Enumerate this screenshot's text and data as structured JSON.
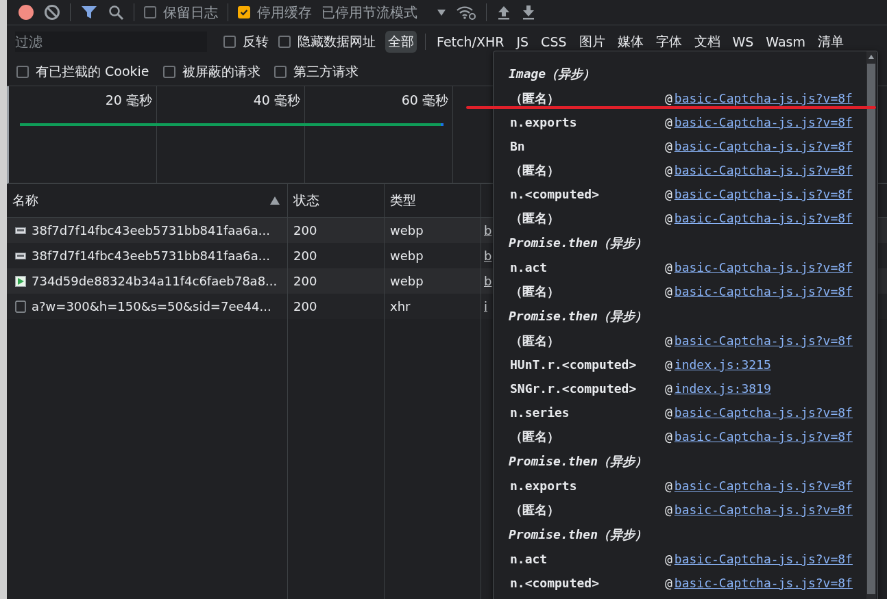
{
  "toolbar": {
    "checkboxes": [
      {
        "label": "保留日志",
        "checked": false
      },
      {
        "label": "停用缓存",
        "checked": true
      }
    ],
    "throttle": "已停用节流模式"
  },
  "filter": {
    "placeholder": "过滤",
    "options": [
      {
        "label": "反转",
        "checked": false
      },
      {
        "label": "隐藏数据网址",
        "checked": false
      }
    ],
    "types": [
      {
        "label": "全部",
        "selected": true
      },
      {
        "label": "Fetch/XHR",
        "selected": false
      },
      {
        "label": "JS",
        "selected": false
      },
      {
        "label": "CSS",
        "selected": false
      },
      {
        "label": "图片",
        "selected": false
      },
      {
        "label": "媒体",
        "selected": false
      },
      {
        "label": "字体",
        "selected": false
      },
      {
        "label": "文档",
        "selected": false
      },
      {
        "label": "WS",
        "selected": false
      },
      {
        "label": "Wasm",
        "selected": false
      },
      {
        "label": "清单",
        "selected": false
      }
    ]
  },
  "more_filters": [
    {
      "label": "有已拦截的 Cookie",
      "checked": false
    },
    {
      "label": "被屏蔽的请求",
      "checked": false
    },
    {
      "label": "第三方请求",
      "checked": false
    }
  ],
  "timeline": {
    "ticks": [
      "20 毫秒",
      "40 毫秒",
      "60 毫秒"
    ]
  },
  "table": {
    "columns": [
      "名称",
      "状态",
      "类型"
    ],
    "rows": [
      {
        "kind": "image",
        "name": "38f7d7f14fbc43eeb5731bb841faa6a...",
        "status": "200",
        "type": "webp",
        "initiator": "b"
      },
      {
        "kind": "image",
        "name": "38f7d7f14fbc43eeb5731bb841faa6a...",
        "status": "200",
        "type": "webp",
        "initiator": "b"
      },
      {
        "kind": "picture",
        "name": "734d59de88324b34a11f4c6faeb78a8...",
        "status": "200",
        "type": "webp",
        "initiator": "b"
      },
      {
        "kind": "document",
        "name": "a?w=300&h=150&s=50&sid=7ee44...",
        "status": "200",
        "type": "xhr",
        "initiator": "i"
      }
    ]
  },
  "initiator_popup": {
    "entries": [
      {
        "kind": "async",
        "label": "Image（异步）"
      },
      {
        "kind": "frame",
        "function": "（匿名）",
        "at": "@",
        "location": "basic-Captcha-js.js?v=8f"
      },
      {
        "kind": "frame",
        "function": "n.exports",
        "at": "@",
        "location": "basic-Captcha-js.js?v=8f"
      },
      {
        "kind": "frame",
        "function": "Bn",
        "at": "@",
        "location": "basic-Captcha-js.js?v=8f"
      },
      {
        "kind": "frame",
        "function": "（匿名）",
        "at": "@",
        "location": "basic-Captcha-js.js?v=8f"
      },
      {
        "kind": "frame",
        "function": "n.<computed>",
        "at": "@",
        "location": "basic-Captcha-js.js?v=8f"
      },
      {
        "kind": "frame",
        "function": "（匿名）",
        "at": "@",
        "location": "basic-Captcha-js.js?v=8f"
      },
      {
        "kind": "async",
        "label": "Promise.then（异步）"
      },
      {
        "kind": "frame",
        "function": "n.act",
        "at": "@",
        "location": "basic-Captcha-js.js?v=8f"
      },
      {
        "kind": "frame",
        "function": "（匿名）",
        "at": "@",
        "location": "basic-Captcha-js.js?v=8f"
      },
      {
        "kind": "async",
        "label": "Promise.then（异步）"
      },
      {
        "kind": "frame",
        "function": "（匿名）",
        "at": "@",
        "location": "basic-Captcha-js.js?v=8f"
      },
      {
        "kind": "frame",
        "function": "HUnT.r.<computed>",
        "at": "@",
        "location": "index.js:3215"
      },
      {
        "kind": "frame",
        "function": "SNGr.r.<computed>",
        "at": "@",
        "location": "index.js:3819"
      },
      {
        "kind": "frame",
        "function": "n.series",
        "at": "@",
        "location": "basic-Captcha-js.js?v=8f"
      },
      {
        "kind": "frame",
        "function": "（匿名）",
        "at": "@",
        "location": "basic-Captcha-js.js?v=8f"
      },
      {
        "kind": "async",
        "label": "Promise.then（异步）"
      },
      {
        "kind": "frame",
        "function": "n.exports",
        "at": "@",
        "location": "basic-Captcha-js.js?v=8f"
      },
      {
        "kind": "frame",
        "function": "（匿名）",
        "at": "@",
        "location": "basic-Captcha-js.js?v=8f"
      },
      {
        "kind": "async",
        "label": "Promise.then（异步）"
      },
      {
        "kind": "frame",
        "function": "n.act",
        "at": "@",
        "location": "basic-Captcha-js.js?v=8f"
      },
      {
        "kind": "frame",
        "function": "n.<computed>",
        "at": "@",
        "location": "basic-Captcha-js.js?v=8f"
      }
    ]
  }
}
